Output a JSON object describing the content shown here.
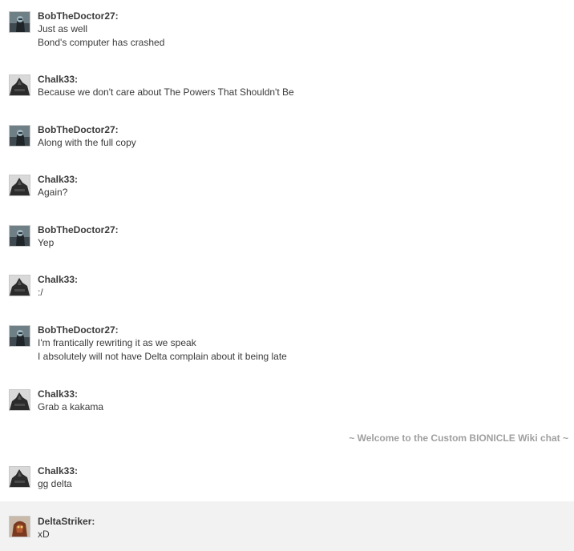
{
  "messages": [
    {
      "user": "BobTheDoctor27:",
      "avatar": "bob-avatar",
      "lines": [
        "Just as well",
        "Bond's computer has crashed"
      ]
    },
    {
      "user": "Chalk33:",
      "avatar": "chalk-avatar",
      "lines": [
        "Because we don't care about The Powers That Shouldn't Be"
      ]
    },
    {
      "user": "BobTheDoctor27:",
      "avatar": "bob-avatar",
      "lines": [
        "Along with the full copy"
      ]
    },
    {
      "user": "Chalk33:",
      "avatar": "chalk-avatar",
      "lines": [
        "Again?"
      ]
    },
    {
      "user": "BobTheDoctor27:",
      "avatar": "bob-avatar",
      "lines": [
        "Yep"
      ]
    },
    {
      "user": "Chalk33:",
      "avatar": "chalk-avatar",
      "lines": [
        ":/"
      ]
    },
    {
      "user": "BobTheDoctor27:",
      "avatar": "bob-avatar",
      "lines": [
        "I'm frantically rewriting it as we speak",
        "I absolutely will not have Delta complain about it being late"
      ]
    },
    {
      "user": "Chalk33:",
      "avatar": "chalk-avatar",
      "lines": [
        "Grab a kakama"
      ]
    },
    {
      "user": "Chalk33:",
      "avatar": "chalk-avatar",
      "lines": [
        "gg delta"
      ]
    },
    {
      "user": "DeltaStriker:",
      "avatar": "delta-avatar",
      "lines": [
        "xD"
      ]
    }
  ],
  "inline_alert": "~ Welcome to the Custom BIONICLE Wiki chat ~",
  "colors": {
    "text": "#3a3a3a",
    "alert": "#a0a0a0",
    "self_highlight": "#f2f2f2"
  }
}
